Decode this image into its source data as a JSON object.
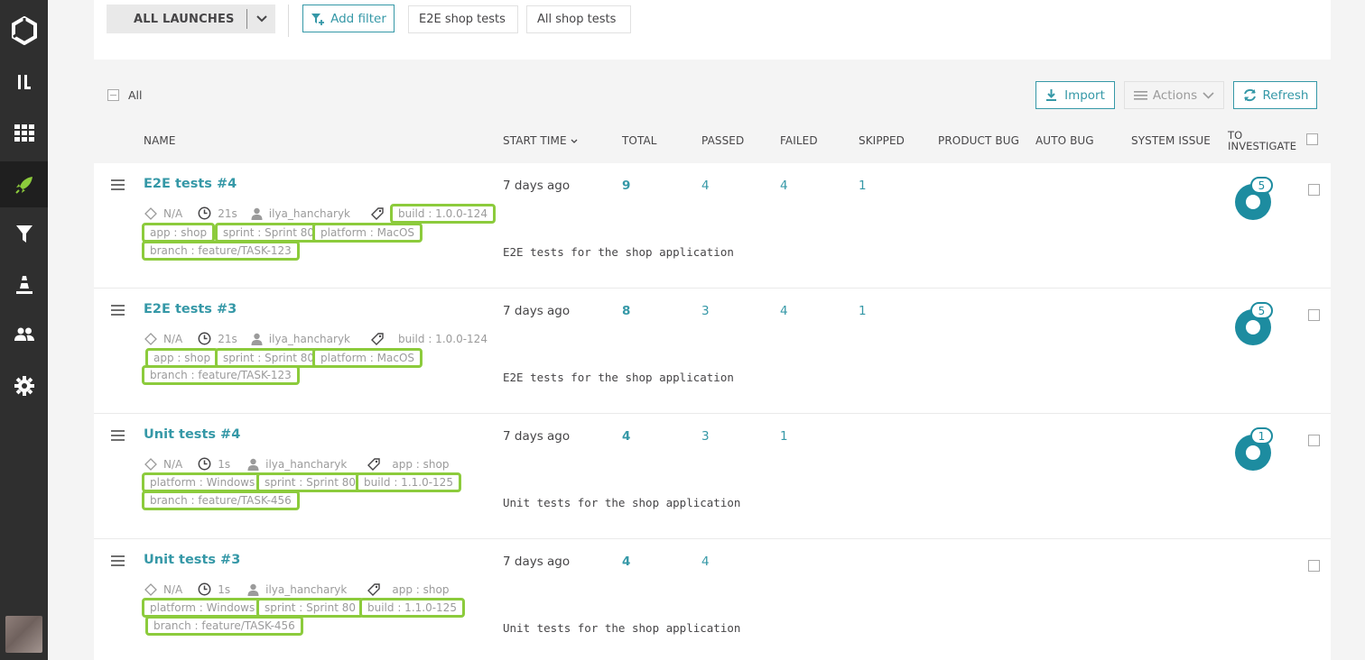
{
  "sidebar": {
    "items": [
      {
        "name": "logo",
        "icon": "hexagon-logo-icon"
      },
      {
        "name": "dashboards",
        "icon": "dashboard-icon"
      },
      {
        "name": "launches",
        "icon": "grid-icon"
      },
      {
        "name": "rocket",
        "icon": "rocket-icon"
      },
      {
        "name": "filters",
        "icon": "funnel-icon"
      },
      {
        "name": "debug",
        "icon": "cone-icon"
      },
      {
        "name": "members",
        "icon": "people-icon"
      },
      {
        "name": "settings",
        "icon": "gear-icon"
      }
    ],
    "avatar": "user-avatar"
  },
  "filter_bar": {
    "launch_select": "ALL LAUNCHES",
    "add_filter": "Add filter",
    "tabs": [
      "E2E shop tests",
      "All shop tests"
    ]
  },
  "toolbar": {
    "all_label": "All",
    "import_label": "Import",
    "actions_label": "Actions",
    "refresh_label": "Refresh"
  },
  "columns": {
    "name": "NAME",
    "start_time": "START TIME",
    "total": "TOTAL",
    "passed": "PASSED",
    "failed": "FAILED",
    "skipped": "SKIPPED",
    "product_bug": "PRODUCT BUG",
    "auto_bug": "AUTO BUG",
    "system_issue": "SYSTEM ISSUE",
    "to_investigate_1": "TO",
    "to_investigate_2": "INVESTIGATE"
  },
  "launches": [
    {
      "name": "E2E tests #4",
      "na": "N/A",
      "duration": "21s",
      "owner": "ilya_hancharyk",
      "tags": [
        "build : 1.0.0-124",
        "app : shop",
        "sprint : Sprint 80",
        "platform : MacOS",
        "branch : feature/TASK-123"
      ],
      "start_time": "7 days ago",
      "description": "E2E tests for the shop application",
      "total": "9",
      "passed": "4",
      "failed": "4",
      "skipped": "1",
      "to_investigate": "5"
    },
    {
      "name": "E2E tests #3",
      "na": "N/A",
      "duration": "21s",
      "owner": "ilya_hancharyk",
      "tags": [
        "build : 1.0.0-124",
        "app : shop",
        "sprint : Sprint 80",
        "platform : MacOS",
        "branch : feature/TASK-123"
      ],
      "start_time": "7 days ago",
      "description": "E2E tests for the shop application",
      "total": "8",
      "passed": "3",
      "failed": "4",
      "skipped": "1",
      "to_investigate": "5"
    },
    {
      "name": "Unit tests #4",
      "na": "N/A",
      "duration": "1s",
      "owner": "ilya_hancharyk",
      "tags": [
        "app : shop",
        "platform : Windows",
        "sprint : Sprint 80",
        "build : 1.1.0-125",
        "branch : feature/TASK-456"
      ],
      "start_time": "7 days ago",
      "description": "Unit tests for the shop application",
      "total": "4",
      "passed": "3",
      "failed": "1",
      "skipped": "",
      "to_investigate": "1"
    },
    {
      "name": "Unit tests #3",
      "na": "N/A",
      "duration": "1s",
      "owner": "ilya_hancharyk",
      "tags": [
        "app : shop",
        "platform : Windows",
        "sprint : Sprint 80",
        "build : 1.1.0-125",
        "branch : feature/TASK-456"
      ],
      "start_time": "7 days ago",
      "description": "Unit tests for the shop application",
      "total": "4",
      "passed": "4",
      "failed": "",
      "skipped": "",
      "to_investigate": ""
    }
  ],
  "colors": {
    "accent": "#3598a7",
    "sidebar": "#2f2f2f",
    "tag_highlight": "#8ccb3c",
    "donut": "#1d8ca0"
  }
}
